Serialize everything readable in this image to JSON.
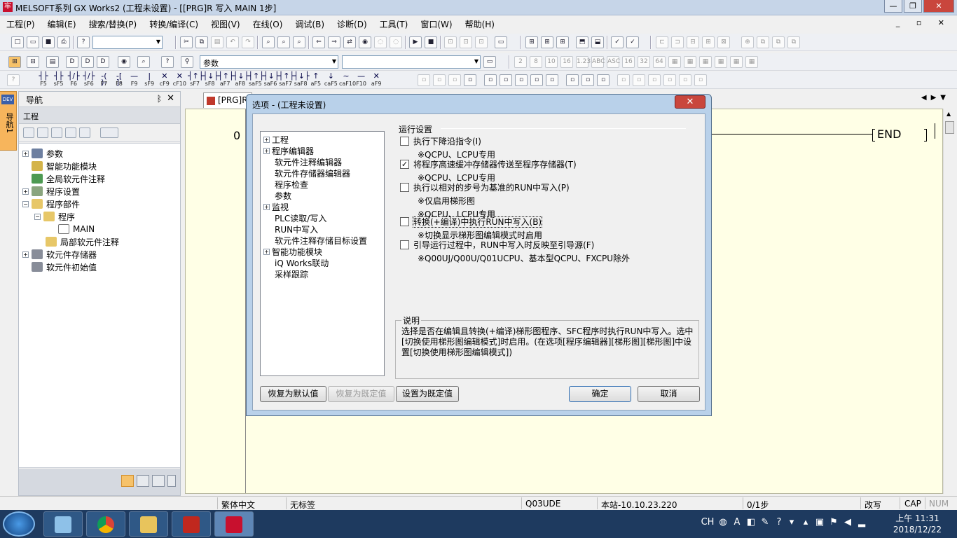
{
  "window": {
    "title": "MELSOFT系列 GX Works2 (工程未设置) - [[PRG]R 写入 MAIN 1步]",
    "app_icon": "melsoft-logo",
    "controls": [
      "minimize-icon",
      "restore-icon",
      "close-icon"
    ]
  },
  "menu": [
    "工程(P)",
    "编辑(E)",
    "搜索/替换(P)",
    "转换/编译(C)",
    "视图(V)",
    "在线(O)",
    "调试(B)",
    "诊断(D)",
    "工具(T)",
    "窗口(W)",
    "帮助(H)"
  ],
  "mdi_controls": "_ ▫ ✕",
  "toolbar": {
    "param_combo": "参数",
    "fkeys": [
      {
        "sym": "┤├",
        "key": "F5"
      },
      {
        "sym": "┤├",
        "key": "sF5"
      },
      {
        "sym": "┤/├",
        "key": "F6"
      },
      {
        "sym": "┤/├",
        "key": "sF6"
      },
      {
        "sym": "-( )-",
        "key": "F7"
      },
      {
        "sym": "-[ ]-",
        "key": "F8"
      },
      {
        "sym": "—",
        "key": "F9"
      },
      {
        "sym": "|",
        "key": "sF9"
      },
      {
        "sym": "✕",
        "key": "cF9"
      },
      {
        "sym": "✕",
        "key": "cF10"
      },
      {
        "sym": "┤↑├",
        "key": "sF7"
      },
      {
        "sym": "┤↓├",
        "key": "sF8"
      },
      {
        "sym": "┤↑├",
        "key": "aF7"
      },
      {
        "sym": "┤↓├",
        "key": "aF8"
      },
      {
        "sym": "┤↑├",
        "key": "saF5"
      },
      {
        "sym": "┤↓├",
        "key": "saF6"
      },
      {
        "sym": "┤↑├",
        "key": "saF7"
      },
      {
        "sym": "┤↓├",
        "key": "saF8"
      },
      {
        "sym": "↑",
        "key": "aF5"
      },
      {
        "sym": "↓",
        "key": "caF5"
      },
      {
        "sym": "~",
        "key": "caF10"
      },
      {
        "sym": "—",
        "key": "F10"
      },
      {
        "sym": "✕",
        "key": "aF9"
      }
    ],
    "bit_icons": [
      "2",
      "8",
      "10",
      "16",
      "1.23",
      "ABC",
      "ASC",
      "16",
      "32",
      "64"
    ]
  },
  "sidebar_tab": "导航1",
  "sidebar_tab_badge": "DEV",
  "navigator": {
    "title": "导航",
    "pin": "ᛒ",
    "close": "✕",
    "section": "工程",
    "tree": [
      {
        "label": "参数",
        "expander": "+",
        "icon": "gear"
      },
      {
        "label": "智能功能模块",
        "expander": "",
        "icon": "ok"
      },
      {
        "label": "全局软元件注释",
        "expander": "",
        "icon": "globe"
      },
      {
        "label": "程序设置",
        "expander": "+",
        "icon": "prog"
      },
      {
        "label": "程序部件",
        "expander": "−",
        "icon": "fold"
      },
      {
        "label": "程序",
        "expander": "−",
        "icon": "fold"
      },
      {
        "label": "MAIN",
        "expander": "",
        "icon": "doc"
      },
      {
        "label": "局部软元件注释",
        "expander": "",
        "icon": "fold"
      },
      {
        "label": "软元件存储器",
        "expander": "+",
        "icon": "mem"
      },
      {
        "label": "软元件初始值",
        "expander": "",
        "icon": "mem"
      }
    ]
  },
  "editor": {
    "tab_label": "[PRG]R",
    "step": "0",
    "end_label": "END"
  },
  "dialog": {
    "title": "选项 - (工程未设置)",
    "close": "✕",
    "tree": [
      {
        "label": "工程",
        "expander": "+"
      },
      {
        "label": "程序编辑器",
        "expander": "+"
      },
      {
        "label": "软元件注释编辑器",
        "expander": ""
      },
      {
        "label": "软元件存储器编辑器",
        "expander": ""
      },
      {
        "label": "程序检查",
        "expander": ""
      },
      {
        "label": "参数",
        "expander": ""
      },
      {
        "label": "监视",
        "expander": "+"
      },
      {
        "label": "PLC读取/写入",
        "expander": ""
      },
      {
        "label": "RUN中写入",
        "expander": ""
      },
      {
        "label": "软元件注释存储目标设置",
        "expander": ""
      },
      {
        "label": "智能功能模块",
        "expander": "+"
      },
      {
        "label": "iQ Works联动",
        "expander": ""
      },
      {
        "label": "采样跟踪",
        "expander": ""
      }
    ],
    "group_title": "运行设置",
    "options": [
      {
        "label": "执行下降沿指令(I)",
        "checked": false,
        "note": "※QCPU、LCPU专用"
      },
      {
        "label": "将程序高速缓冲存储器传送至程序存储器(T)",
        "checked": true,
        "note": "※QCPU、LCPU专用"
      },
      {
        "label": "执行以相对的步号为基准的RUN中写入(P)",
        "checked": false,
        "note": "※仅启用梯形图",
        "note2": "※QCPU、LCPU专用"
      },
      {
        "label": "转换(+编译)中执行RUN中写入(B)",
        "checked": false,
        "note": "※切换显示梯形图编辑模式时启用"
      },
      {
        "label": "引导运行过程中，RUN中写入时反映至引导源(F)",
        "checked": false,
        "note": "※Q00UJ/Q00U/Q01UCPU、基本型QCPU、FXCPU除外"
      }
    ],
    "desc_label": "说明",
    "desc_text": "选择是否在编辑且转换(+编译)梯形图程序、SFC程序时执行RUN中写入。选中[切换使用梯形图编辑模式]时启用。(在选项[程序编辑器][梯形图][梯形图]中设置[切换使用梯形图编辑模式])",
    "buttons": {
      "restore_default": "恢复为默认值",
      "restore_preset": "恢复为既定值",
      "set_preset": "设置为既定值",
      "ok": "确定",
      "cancel": "取消"
    }
  },
  "status": {
    "language": "繁体中文",
    "label": "无标签",
    "cpu": "Q03UDE",
    "station": "本站-10.10.23.220",
    "steps": "0/1步",
    "mode": "改写",
    "caps": "CAP",
    "num": "NUM"
  },
  "taskbar": {
    "lang": "CH",
    "time": "上午 11:31",
    "date": "2018/12/22"
  },
  "colors": {
    "editor_bg": "#ffffe6",
    "dialog_frame": "#b9d1ea",
    "taskbar": "#1e3a5f",
    "close_red": "#c9463d"
  }
}
